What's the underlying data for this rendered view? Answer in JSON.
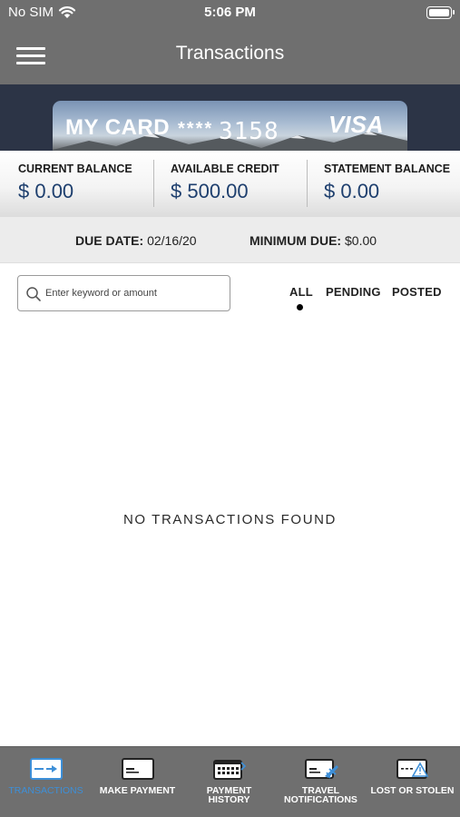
{
  "status_bar": {
    "carrier": "No SIM",
    "time": "5:06 PM"
  },
  "header": {
    "title": "Transactions"
  },
  "card": {
    "name": "MY CARD",
    "mask": "****",
    "last_four": "3158",
    "network": "VISA"
  },
  "balances": [
    {
      "label": "CURRENT BALANCE",
      "value": "$ 0.00"
    },
    {
      "label": "AVAILABLE CREDIT",
      "value": "$ 500.00"
    },
    {
      "label": "STATEMENT BALANCE",
      "value": "$ 0.00"
    }
  ],
  "due": {
    "date_label": "DUE DATE:",
    "date_value": "02/16/20",
    "minimum_label": "MINIMUM DUE:",
    "minimum_value": "$0.00"
  },
  "search": {
    "placeholder": "Enter keyword or amount",
    "value": ""
  },
  "filters": {
    "all": "ALL",
    "pending": "PENDING",
    "posted": "POSTED",
    "selected": "ALL"
  },
  "empty_message": "NO TRANSACTIONS FOUND",
  "tabs": [
    {
      "label": "TRANSACTIONS",
      "icon": "transactions-card-icon",
      "active": true
    },
    {
      "label": "MAKE PAYMENT",
      "icon": "payment-card-icon",
      "active": false
    },
    {
      "label_line1": "PAYMENT",
      "label_line2": "HISTORY",
      "icon": "payment-history-icon",
      "active": false
    },
    {
      "label_line1": "TRAVEL",
      "label_line2": "NOTIFICATIONS",
      "icon": "travel-notifications-icon",
      "active": false
    },
    {
      "label": "LOST OR STOLEN",
      "icon": "lost-stolen-icon",
      "active": false
    }
  ],
  "colors": {
    "header_bg": "#6f6f6f",
    "accent": "#3d8fd8",
    "balance_text": "#1e3f6e",
    "card_banner_bg": "#2c3446"
  }
}
